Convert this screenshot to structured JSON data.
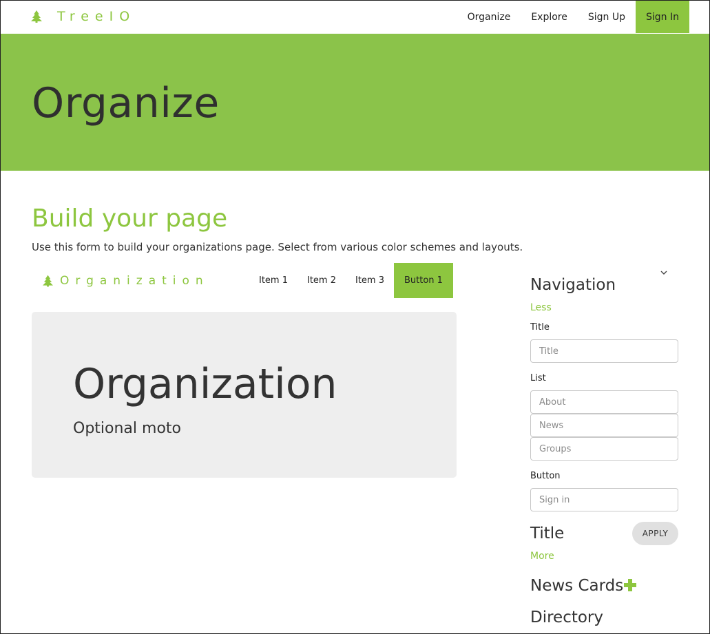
{
  "navbar": {
    "brand": "TreeIO",
    "links": [
      "Organize",
      "Explore",
      "Sign Up"
    ],
    "signin": "Sign In"
  },
  "hero": {
    "title": "Organize"
  },
  "build": {
    "title": "Build your page",
    "description": "Use this form to build your organizations page. Select from various color schemes and layouts."
  },
  "preview": {
    "brand": "Organization",
    "nav_items": [
      "Item 1",
      "Item 2",
      "Item 3"
    ],
    "button": "Button 1",
    "title": "Organization",
    "moto": "Optional moto"
  },
  "sidebar": {
    "navigation_heading": "Navigation",
    "less_link": "Less",
    "title_label": "Title",
    "title_placeholder": "Title",
    "list_label": "List",
    "list_placeholders": [
      "About",
      "News",
      "Groups"
    ],
    "button_label": "Button",
    "button_placeholder": "Sign in",
    "title_heading": "Title",
    "apply": "APPLY",
    "more_link": "More",
    "news_cards_heading": "News Cards",
    "directory_heading": "Directory"
  },
  "colors": {
    "accent": "#8dc63f",
    "hero_bg": "#8bc34a",
    "card_bg": "#eeeeee"
  },
  "icons": {
    "brand": "tree-icon",
    "collapse": "chevron-down-icon",
    "add": "plus-icon"
  }
}
